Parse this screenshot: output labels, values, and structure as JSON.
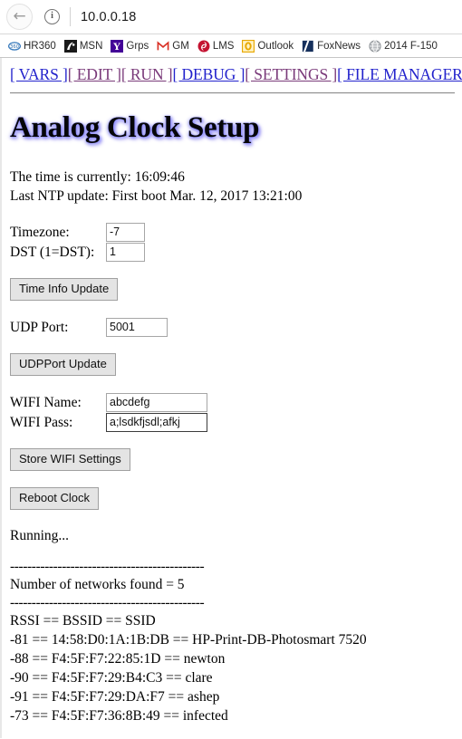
{
  "browser": {
    "back_label": "←",
    "info_label": "i",
    "url": "10.0.0.18",
    "bookmarks": [
      {
        "label": "HR360",
        "icon": "hr360-icon"
      },
      {
        "label": "MSN",
        "icon": "msn-icon"
      },
      {
        "label": "Grps",
        "icon": "yahoo-groups-icon"
      },
      {
        "label": "GM",
        "icon": "gmail-icon"
      },
      {
        "label": "LMS",
        "icon": "lms-icon"
      },
      {
        "label": "Outlook",
        "icon": "outlook-icon"
      },
      {
        "label": "FoxNews",
        "icon": "foxnews-icon"
      },
      {
        "label": "2014 F-150",
        "icon": "globe-icon"
      }
    ]
  },
  "nav": {
    "items": [
      {
        "label": "[ VARS ]",
        "state": "unvisited"
      },
      {
        "label": "[ EDIT ]",
        "state": "visited"
      },
      {
        "label": "[ RUN ]",
        "state": "visited"
      },
      {
        "label": "[ DEBUG ]",
        "state": "unvisited"
      },
      {
        "label": "[ SETTINGS ]",
        "state": "visited"
      },
      {
        "label": "[ FILE MANAGER ]",
        "state": "unvisited"
      }
    ]
  },
  "page": {
    "title": "Analog Clock Setup",
    "current_time_line": "The time is currently: 16:09:46",
    "last_ntp_line": "Last NTP update: First boot Mar. 12, 2017 13:21:00",
    "status_line": "Running...",
    "divider": "---------------------------------------------",
    "networks_found_line": "Number of networks found = 5",
    "network_header": "RSSI == BSSID == SSID",
    "networks": [
      "-81 == 14:58:D0:1A:1B:DB == HP-Print-DB-Photosmart 7520",
      "-88 == F4:5F:F7:22:85:1D == newton",
      "-90 == F4:5F:F7:29:B4:C3 == clare",
      "-91 == F4:5F:F7:29:DA:F7 == ashep",
      "-73 == F4:5F:F7:36:8B:49 == infected"
    ]
  },
  "form": {
    "timezone_label": "Timezone:",
    "timezone_value": "-7",
    "dst_label": "DST (1=DST):",
    "dst_value": "1",
    "time_update_button": "Time Info Update",
    "udp_label": "UDP Port:",
    "udp_value": "5001",
    "udp_update_button": "UDPPort Update",
    "wifi_name_label": "WIFI Name:",
    "wifi_name_value": "abcdefg",
    "wifi_pass_label": "WIFI Pass:",
    "wifi_pass_value": "a;lsdkfjsdl;afkj",
    "store_wifi_button": "Store WIFI Settings",
    "reboot_button": "Reboot Clock"
  },
  "colors": {
    "link_unvisited": "#2222cc",
    "link_visited": "#7a3a7a",
    "title_glow": "#8f8fff"
  }
}
